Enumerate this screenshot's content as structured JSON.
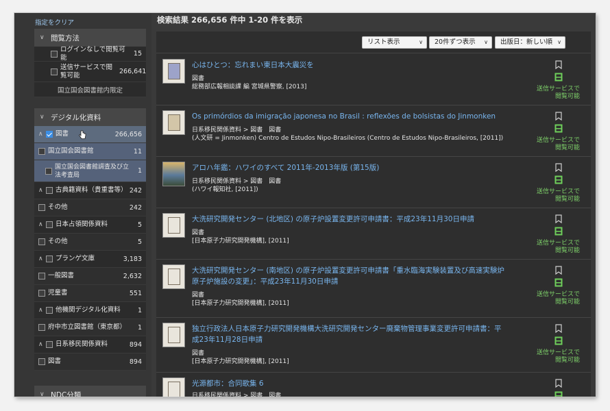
{
  "clear_filters": "指定をクリア",
  "facets": {
    "access": {
      "title": "閲覧方法",
      "items": [
        {
          "label": "ログインなしで閲覧可能",
          "count": "15"
        },
        {
          "label": "送信サービスで閲覧可能",
          "count": "266,641"
        }
      ],
      "note": "国立国会図書館内限定"
    },
    "digital": {
      "title": "デジタル化資料",
      "rows": [
        {
          "label": "図書",
          "count": "266,656",
          "checked": true
        },
        {
          "label": "国立国会図書館",
          "count": "11"
        },
        {
          "label": "国立国会図書館調査及び立法考査局",
          "count": "1"
        },
        {
          "label": "古典籍資料（貴重書等）",
          "count": "242"
        },
        {
          "label": "その他",
          "count": "242"
        },
        {
          "label": "日本占領関係資料",
          "count": "5"
        },
        {
          "label": "その他",
          "count": "5"
        },
        {
          "label": "プランゲ文庫",
          "count": "3,183"
        },
        {
          "label": "一般図書",
          "count": "2,632"
        },
        {
          "label": "児童書",
          "count": "551"
        },
        {
          "label": "他機関デジタル化資料",
          "count": "1"
        },
        {
          "label": "府中市立図書館（東京都）",
          "count": "1"
        },
        {
          "label": "日系移民関係資料",
          "count": "894"
        },
        {
          "label": "図書",
          "count": "894"
        }
      ]
    },
    "ndc": {
      "title": "NDC分類"
    }
  },
  "header": {
    "summary": "検索結果 266,656 件中 1-20 件を表示"
  },
  "toolbar": {
    "view": "リスト表示",
    "per_page": "20件ずつ表示",
    "sort": "出版日：新しい順"
  },
  "results": [
    {
      "title": "心はひとつ：忘れまい東日本大震災を",
      "type": "図書",
      "publisher": "総務部広報相談課 編 宮城県警察, [2013]",
      "service": [
        "送信サービスで",
        "閲覧可能"
      ]
    },
    {
      "title": "Os primórdios da imigração japonesa no Brasil : reflexões de bolsistas do Jinmonken",
      "type": "日系移民関係資料 > 図書　図書",
      "publisher": "(人文研 = Jinmonken) Centro de Estudos Nipo-Brasileiros (Centro de Estudos Nipo-Brasileiros, [2011])",
      "service": [
        "送信サービスで",
        "閲覧可能"
      ]
    },
    {
      "title": "アロハ年鑑：ハワイのすべて 2011年-2013年版 (第15版)",
      "type": "日系移民関係資料 > 図書　図書",
      "publisher": "(ハワイ報知社, [2011])",
      "service": [
        "送信サービスで",
        "閲覧可能"
      ]
    },
    {
      "title": "大洗研究開発センター (北地区) の原子炉設置変更許可申請書：平成23年11月30日申請",
      "type": "図書",
      "publisher": "[日本原子力研究開発機構], [2011]",
      "service": [
        "送信サービスで",
        "閲覧可能"
      ]
    },
    {
      "title": "大洗研究開発センター (南地区) の原子炉設置変更許可申請書「重水臨海実験装置及び高速実験炉原子炉施設の変更」：平成23年11月30日申請",
      "type": "図書",
      "publisher": "[日本原子力研究開発機構], [2011]",
      "service": [
        "送信サービスで",
        "閲覧可能"
      ]
    },
    {
      "title": "独立行政法人日本原子力研究開発機構大洗研究開発センター廃棄物管理事業変更許可申請書：平成23年11月28日申請",
      "type": "図書",
      "publisher": "[日本原子力研究開発機構], [2011]",
      "service": [
        "送信サービスで",
        "閲覧可能"
      ]
    },
    {
      "title": "光源都市：合同歌集 6",
      "type": "日系移民関係資料 > 図書　図書",
      "publisher": "",
      "service": []
    }
  ],
  "colors": {
    "link": "#79b6ef",
    "service": "#7fd26a",
    "selected_row": "#5d6b7e"
  }
}
